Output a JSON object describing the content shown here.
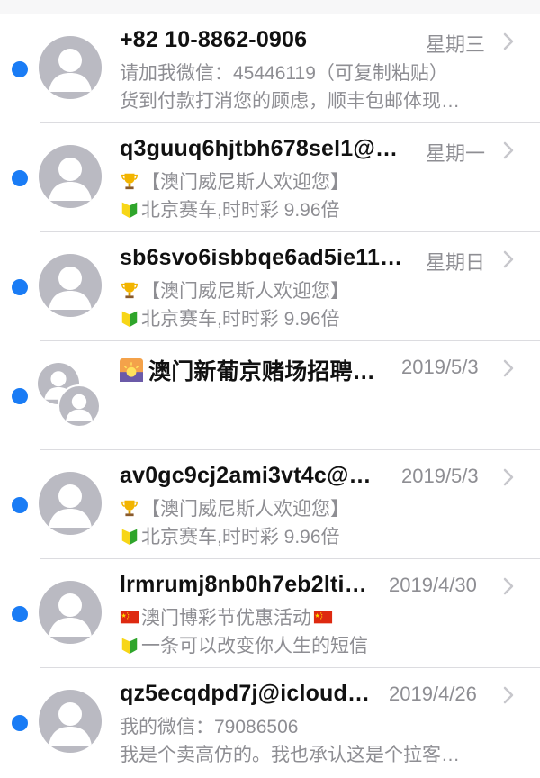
{
  "conversations": [
    {
      "sender": "+82 10-8862-0906",
      "date": "星期三",
      "line1": "请加我微信：45446119（可复制粘贴）",
      "line2": "货到付款打消您的顾虑，顺丰包邮体现…",
      "unread": true
    },
    {
      "sender": "q3guuq6hjtbh678sel1@…",
      "date": "星期一",
      "line1": "【澳门威尼斯人欢迎您】",
      "line2": "北京赛车,时时彩 9.96倍",
      "line1_icon": "trophy-icon",
      "line2_icon": "beginner-badge-icon",
      "unread": true
    },
    {
      "sender": "sb6svo6isbbqe6ad5ie11…",
      "date": "星期日",
      "line1": "【澳门威尼斯人欢迎您】",
      "line2": "北京赛车,时时彩 9.96倍",
      "line1_icon": "trophy-icon",
      "line2_icon": "beginner-badge-icon",
      "unread": true
    },
    {
      "sender": "澳门新葡京赌场招聘…",
      "date": "2019/5/3",
      "sender_icon": "sunrise-icon",
      "group": true,
      "unread": true
    },
    {
      "sender": "av0gc9cj2ami3vt4c@…",
      "date": "2019/5/3",
      "line1": "【澳门威尼斯人欢迎您】",
      "line2": "北京赛车,时时彩 9.96倍",
      "line1_icon": "trophy-icon",
      "line2_icon": "beginner-badge-icon",
      "unread": true
    },
    {
      "sender": "lrmrumj8nb0h7eb2lti…",
      "date": "2019/4/30",
      "line1": "澳门博彩节优惠活动",
      "line2": "一条可以改变你人生的短信",
      "line1_icon": "china-flag-icon",
      "line2_icon": "beginner-badge-icon",
      "unread": true
    },
    {
      "sender": "qz5ecqdpd7j@icloud…",
      "date": "2019/4/26",
      "line1": "我的微信：79086506",
      "line2": "我是个卖高仿的。我也承认这是个拉客…",
      "unread": true
    }
  ],
  "colors": {
    "unread_dot": "#1a7cf5",
    "avatar": "#babac2",
    "secondary_text": "#8e8e93"
  }
}
